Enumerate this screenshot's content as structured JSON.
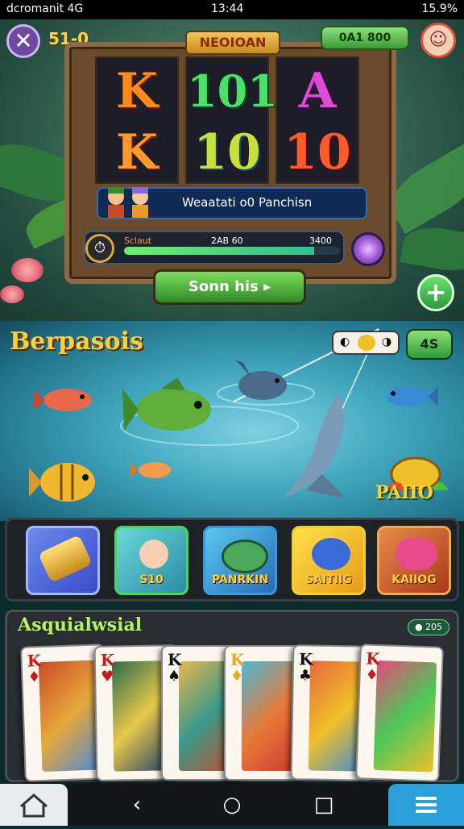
{
  "status_bar": {
    "left": "dcromanit 4G",
    "time": "13:44",
    "battery": "15.9%"
  },
  "top": {
    "level": "51-0",
    "coins": "0A1 800"
  },
  "slot": {
    "title": "NEOIOAN",
    "reels": [
      [
        "K",
        "K"
      ],
      [
        "101",
        "10"
      ],
      [
        "A",
        "10"
      ]
    ],
    "info_text": "Weaatati o0  Panchisn",
    "progress": {
      "left_label": "Sclaut",
      "mid_label": "2AB 60",
      "right_label": "3400",
      "fraction": 0.88
    },
    "spin_label": "Sonn  his  ▸"
  },
  "fishing": {
    "title": "Berpasois",
    "bait_count": "4S",
    "reward_label": "PAIIO"
  },
  "items": [
    {
      "label": ""
    },
    {
      "label": "S10"
    },
    {
      "label": "PANRKIN"
    },
    {
      "label": "SAITIIG"
    },
    {
      "label": "KAIIOG"
    }
  ],
  "cards_section": {
    "title": "Asquialwsial",
    "badge": "205",
    "cards": [
      {
        "rank": "K",
        "suit": "♦"
      },
      {
        "rank": "K",
        "suit": "♥"
      },
      {
        "rank": "K",
        "suit": "♠"
      },
      {
        "rank": "K",
        "suit": "♦"
      },
      {
        "rank": "K",
        "suit": "♣"
      },
      {
        "rank": "K",
        "suit": "♦"
      }
    ]
  },
  "colors": {
    "accent_green": "#3c9b36",
    "gold": "#ffcf3a",
    "nav_blue": "#2aa0d8"
  }
}
